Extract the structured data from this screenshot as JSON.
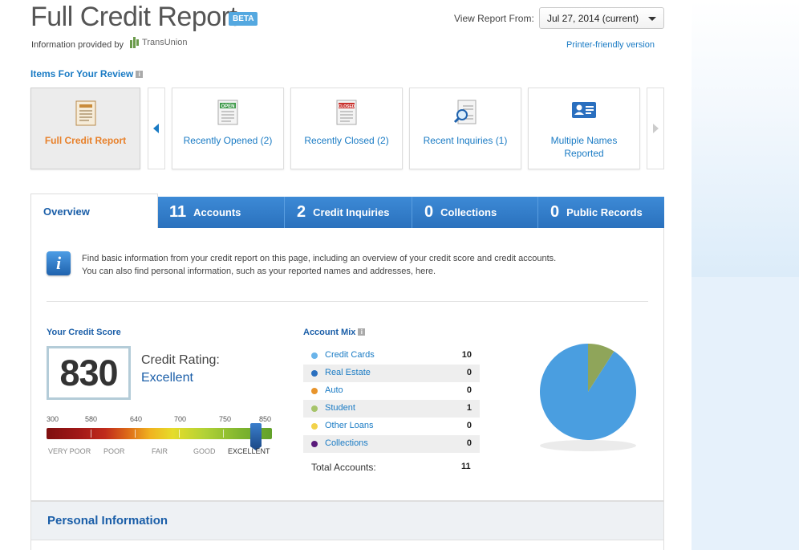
{
  "header": {
    "title": "Full Credit Report",
    "beta_badge": "BETA",
    "provided_by": "Information provided by",
    "provider_name": "TransUnion",
    "view_report_label": "View Report From:",
    "view_report_selected": "Jul 27, 2014 (current)",
    "printer_link": "Printer-friendly version"
  },
  "review": {
    "title": "Items For Your Review",
    "cards": [
      {
        "label": "Full Credit Report",
        "icon": "report-doc-icon",
        "active": true
      },
      {
        "label": "Recently Opened (2)",
        "icon": "open-doc-icon",
        "tag": "OPEN"
      },
      {
        "label": "Recently Closed (2)",
        "icon": "closed-doc-icon",
        "tag": "CLOSED"
      },
      {
        "label": "Recent Inquiries (1)",
        "icon": "magnifier-doc-icon"
      },
      {
        "label": "Multiple Names Reported",
        "icon": "id-card-icon"
      }
    ]
  },
  "tabs": {
    "overview": "Overview",
    "accounts": {
      "num": "11",
      "label": "Accounts"
    },
    "inquiries": {
      "num": "2",
      "label": "Credit Inquiries"
    },
    "collections": {
      "num": "0",
      "label": "Collections"
    },
    "public_records": {
      "num": "0",
      "label": "Public Records"
    }
  },
  "info": {
    "line1": "Find basic information from your credit report on this page, including an overview of your credit score and credit accounts.",
    "line2": "You can also find personal information, such as your reported names and addresses, here."
  },
  "score": {
    "title": "Your Credit Score",
    "value": "830",
    "rating_label": "Credit Rating:",
    "rating_value": "Excellent",
    "scale_numbers": [
      "300",
      "580",
      "640",
      "700",
      "750",
      "850"
    ],
    "scale_words": [
      "VERY POOR",
      "POOR",
      "FAIR",
      "GOOD",
      "EXCELLENT"
    ],
    "range_min": 300,
    "range_max": 850,
    "score_number": 830
  },
  "account_mix": {
    "title": "Account Mix",
    "rows": [
      {
        "name": "Credit Cards",
        "count": "10",
        "color": "#6ab4ea"
      },
      {
        "name": "Real Estate",
        "count": "0",
        "color": "#2a6fbf"
      },
      {
        "name": "Auto",
        "count": "0",
        "color": "#e8942b"
      },
      {
        "name": "Student",
        "count": "1",
        "color": "#a6c46a"
      },
      {
        "name": "Other Loans",
        "count": "0",
        "color": "#f2d24a"
      },
      {
        "name": "Collections",
        "count": "0",
        "color": "#5a1a7a"
      }
    ],
    "total_label": "Total Accounts:",
    "total_value": "11"
  },
  "chart_data": {
    "type": "pie",
    "categories": [
      "Credit Cards",
      "Student"
    ],
    "values": [
      10,
      1
    ],
    "colors": [
      "#4a9ee0",
      "#8fa55a"
    ]
  },
  "personal": {
    "title": "Personal Information"
  }
}
